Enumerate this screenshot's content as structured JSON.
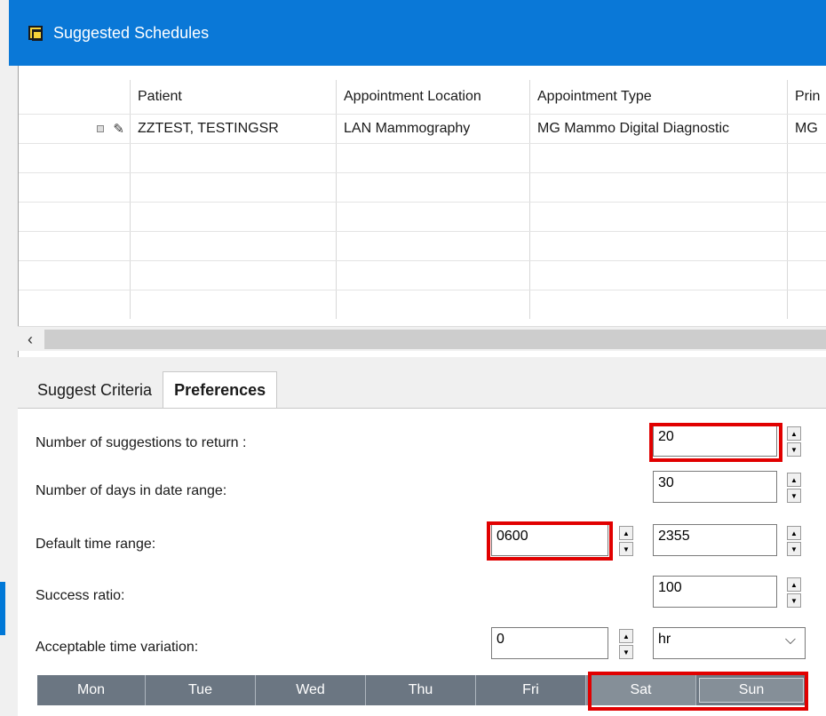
{
  "window": {
    "title": "Suggested Schedules"
  },
  "grid": {
    "columns": [
      "Patient",
      "Appointment Location",
      "Appointment Type",
      "Prin"
    ],
    "rows": [
      {
        "patient": "ZZTEST, TESTINGSR",
        "location": "LAN Mammography",
        "type": "MG Mammo Digital Diagnostic",
        "prin": "MG"
      }
    ]
  },
  "scrollbar": {
    "left_arrow": "‹"
  },
  "tabs": [
    {
      "label": "Suggest Criteria",
      "active": false
    },
    {
      "label": "Preferences",
      "active": true
    }
  ],
  "preferences": {
    "num_suggestions_label": "Number of suggestions to return :",
    "num_suggestions_value": "20",
    "num_days_label": "Number of days in date range:",
    "num_days_value": "30",
    "time_range_label": "Default time range:",
    "time_range_start": "0600",
    "time_range_end": "2355",
    "success_ratio_label": "Success ratio:",
    "success_ratio_value": "100",
    "time_variation_label": "Acceptable time variation:",
    "time_variation_value": "0",
    "time_variation_unit": "hr"
  },
  "days": [
    "Mon",
    "Tue",
    "Wed",
    "Thu",
    "Fri",
    "Sat",
    "Sun"
  ],
  "colors": {
    "titlebar": "#0a78d7",
    "highlight": "#e10000",
    "days_bg": "#6b7682"
  },
  "icons": {
    "app": "calendar-icon",
    "row_indicator": "square-icon",
    "edit": "pencil-icon",
    "dropdown": "chevron-down-icon"
  }
}
